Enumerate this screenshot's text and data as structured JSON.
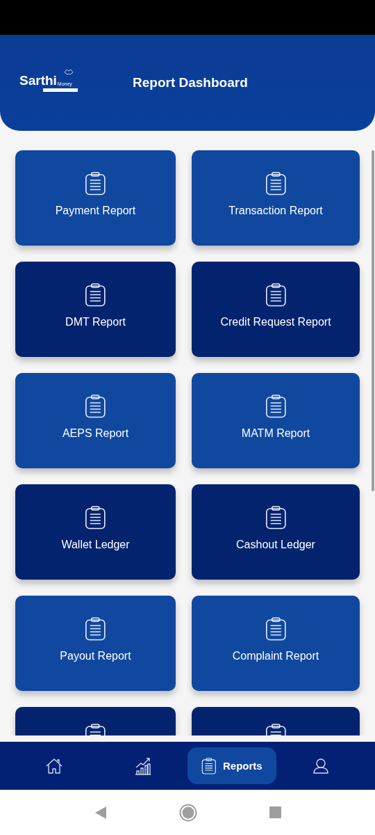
{
  "header": {
    "logo": {
      "name": "Sarthi",
      "suffix": "Money"
    },
    "title": "Report Dashboard"
  },
  "cards": [
    {
      "kind": "report",
      "label": "Payment Report",
      "color": "#1048a0"
    },
    {
      "kind": "report",
      "label": "Transaction Report",
      "color": "#1048a0"
    },
    {
      "kind": "report",
      "label": "DMT Report",
      "color": "#03236f"
    },
    {
      "kind": "report",
      "label": "Credit Request Report",
      "color": "#03236f"
    },
    {
      "kind": "report",
      "label": "AEPS Report",
      "color": "#1048a0"
    },
    {
      "kind": "report",
      "label": "MATM Report",
      "color": "#1048a0"
    },
    {
      "kind": "report",
      "label": "Wallet Ledger",
      "color": "#03236f"
    },
    {
      "kind": "report",
      "label": "Cashout Ledger",
      "color": "#03236f"
    },
    {
      "kind": "report",
      "label": "Payout Report",
      "color": "#1048a0"
    },
    {
      "kind": "report",
      "label": "Complaint Report",
      "color": "#1048a0"
    },
    {
      "kind": "cut",
      "color": "#03236f"
    },
    {
      "kind": "cut",
      "color": "#03236f"
    }
  ],
  "bottom_nav": [
    {
      "kind": "home",
      "selected": false
    },
    {
      "kind": "chart",
      "selected": false
    },
    {
      "kind": "reports",
      "label": "Reports",
      "selected": true
    },
    {
      "kind": "profile",
      "selected": false
    }
  ]
}
